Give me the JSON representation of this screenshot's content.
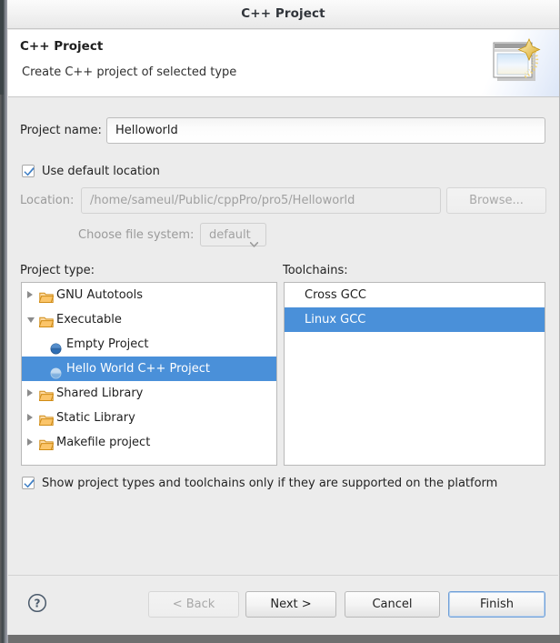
{
  "window": {
    "title": "C++ Project"
  },
  "header": {
    "title": "C++ Project",
    "description": "Create C++ project of selected type",
    "icon": "new-cpp-project-wizard-icon"
  },
  "form": {
    "project_name_label": "Project name:",
    "project_name_value": "Helloworld",
    "use_default_location_label": "Use default location",
    "use_default_location_checked": true,
    "location_label": "Location:",
    "location_value": "/home/sameul/Public/cppPro/pro5/Helloworld",
    "browse_label": "Browse...",
    "file_system_label": "Choose file system:",
    "file_system_value": "default",
    "file_system_options": [
      "default"
    ]
  },
  "project_type": {
    "label": "Project type:",
    "items": [
      {
        "label": "GNU Autotools",
        "kind": "folder",
        "state": "collapsed",
        "indent": 0,
        "selected": false
      },
      {
        "label": "Executable",
        "kind": "folder",
        "state": "expanded",
        "indent": 0,
        "selected": false
      },
      {
        "label": "Empty Project",
        "kind": "leaf",
        "state": "none",
        "indent": 1,
        "selected": false
      },
      {
        "label": "Hello World C++ Project",
        "kind": "leaf",
        "state": "none",
        "indent": 1,
        "selected": true
      },
      {
        "label": "Shared Library",
        "kind": "folder",
        "state": "collapsed",
        "indent": 0,
        "selected": false
      },
      {
        "label": "Static Library",
        "kind": "folder",
        "state": "collapsed",
        "indent": 0,
        "selected": false
      },
      {
        "label": "Makefile project",
        "kind": "folder",
        "state": "collapsed",
        "indent": 0,
        "selected": false
      }
    ]
  },
  "toolchains": {
    "label": "Toolchains:",
    "items": [
      {
        "label": "Cross GCC",
        "selected": false
      },
      {
        "label": "Linux GCC",
        "selected": true
      }
    ]
  },
  "options": {
    "show_supported_label": "Show project types and toolchains only if they are supported on the platform",
    "show_supported_checked": true
  },
  "buttons": {
    "help": "?",
    "back": "< Back",
    "next": "Next >",
    "cancel": "Cancel",
    "finish": "Finish"
  },
  "colors": {
    "selection_blue": "#4a90d9",
    "dialog_bg": "#ececec",
    "folder_orange": "#f0a830",
    "focus_blue": "#6f9fd8"
  }
}
